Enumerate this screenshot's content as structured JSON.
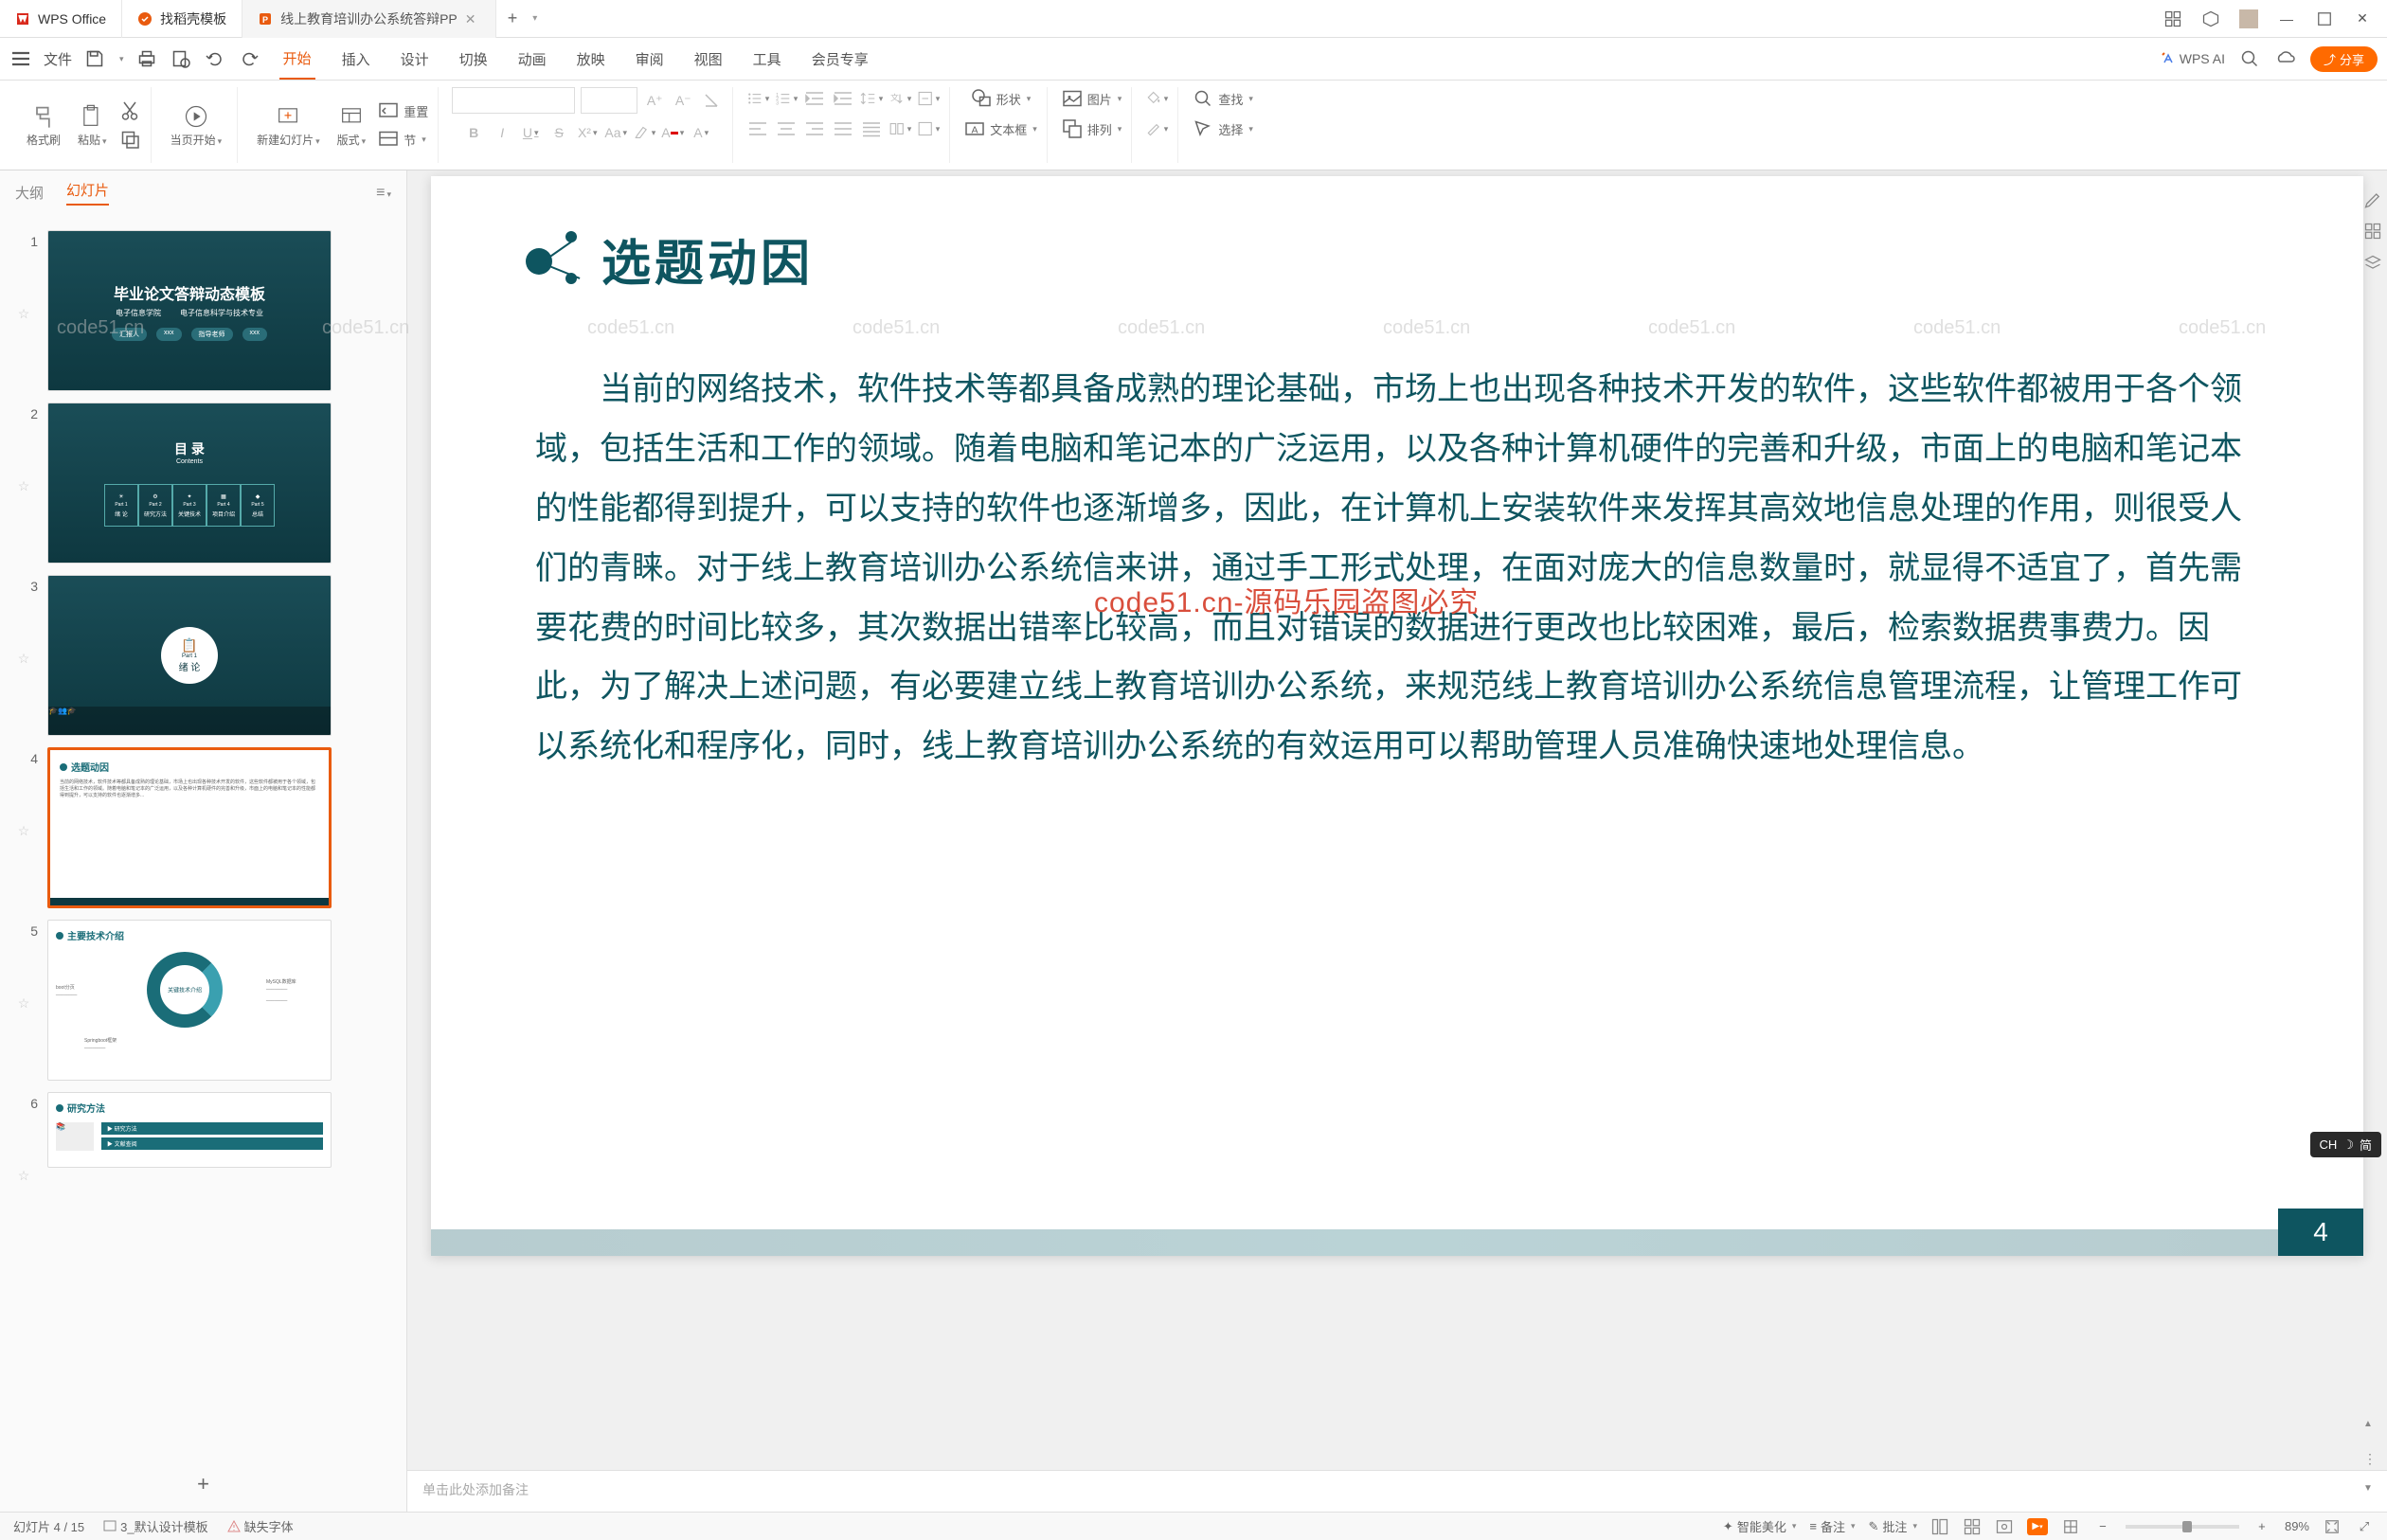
{
  "titlebar": {
    "app_name": "WPS Office",
    "tabs": [
      {
        "label": "找稻壳模板"
      },
      {
        "label": "线上教育培训办公系统答辩PP",
        "active": true
      }
    ]
  },
  "menubar": {
    "file": "文件",
    "tabs": [
      "开始",
      "插入",
      "设计",
      "切换",
      "动画",
      "放映",
      "审阅",
      "视图",
      "工具",
      "会员专享"
    ],
    "active_tab": "开始",
    "wps_ai": "WPS AI",
    "share": "分享"
  },
  "ribbon": {
    "format_painter": "格式刷",
    "paste": "粘贴",
    "from_current": "当页开始",
    "new_slide": "新建幻灯片",
    "layout": "版式",
    "section": "节",
    "reset": "重置",
    "shape": "形状",
    "picture": "图片",
    "textbox": "文本框",
    "arrange": "排列",
    "find": "查找",
    "select": "选择"
  },
  "leftpanel": {
    "outline": "大纲",
    "slides": "幻灯片",
    "thumb1_title": "毕业论文答辩动态模板",
    "thumb1_sub1": "电子信息学院",
    "thumb1_sub2": "电子信息科学与技术专业",
    "thumb1_btn1": "汇报人",
    "thumb1_btn2": "指导老师",
    "thumb2_title": "目 录",
    "thumb2_sub": "Contents",
    "thumb2_items": [
      "绪 论",
      "研究方法",
      "关键技术",
      "项目介绍",
      "总结"
    ],
    "thumb3_part": "Part 1",
    "thumb3_label": "绪 论",
    "thumb4_title": "选题动因",
    "thumb5_title": "主要技术介绍",
    "thumb5_center": "关键技术介绍",
    "thumb6_title": "研究方法"
  },
  "slide": {
    "title": "选题动因",
    "body": "当前的网络技术，软件技术等都具备成熟的理论基础，市场上也出现各种技术开发的软件，这些软件都被用于各个领域，包括生活和工作的领域。随着电脑和笔记本的广泛运用，以及各种计算机硬件的完善和升级，市面上的电脑和笔记本的性能都得到提升，可以支持的软件也逐渐增多，因此，在计算机上安装软件来发挥其高效地信息处理的作用，则很受人们的青睐。对于线上教育培训办公系统信来讲，通过手工形式处理，在面对庞大的信息数量时，就显得不适宜了，首先需要花费的时间比较多，其次数据出错率比较高，而且对错误的数据进行更改也比较困难，最后，检索数据费事费力。因此，为了解决上述问题，有必要建立线上教育培训办公系统，来规范线上教育培训办公系统信息管理流程，让管理工作可以系统化和程序化，同时，线上教育培训办公系统的有效运用可以帮助管理人员准确快速地处理信息。",
    "page_num": "4"
  },
  "notes": {
    "placeholder": "单击此处添加备注"
  },
  "statusbar": {
    "slide_info": "幻灯片 4 / 15",
    "template": "3_默认设计模板",
    "missing_font": "缺失字体",
    "smart_beautify": "智能美化",
    "notes": "备注",
    "comments": "批注",
    "zoom": "89%"
  },
  "ime": {
    "label": "CH",
    "mode": "简"
  },
  "watermark_red": "code51.cn-源码乐园盗图必究",
  "watermark": "code51.cn"
}
